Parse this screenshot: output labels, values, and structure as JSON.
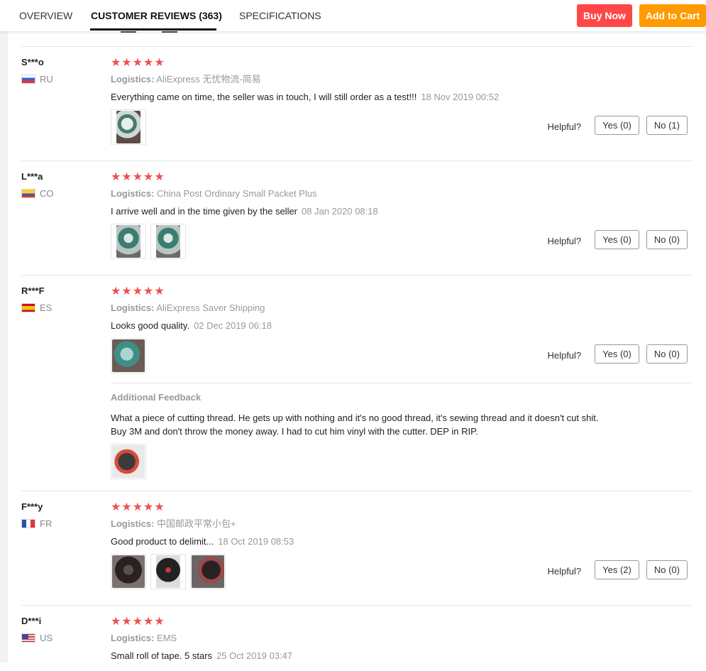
{
  "tabs": [
    {
      "label": "OVERVIEW",
      "active": false
    },
    {
      "label": "CUSTOMER REVIEWS (363)",
      "active": true
    },
    {
      "label": "SPECIFICATIONS",
      "active": false
    }
  ],
  "actions": {
    "buy_now": "Buy Now",
    "add_to_cart": "Add to Cart"
  },
  "colors": {
    "buy_now": "#ff4747",
    "add_to_cart": "#ff9a00",
    "stars": "#f05050"
  },
  "helpful_label": "Helpful?",
  "logistics_label": "Logistics:",
  "reviews": [
    {
      "user": "S***o",
      "country": "RU",
      "stars": "★★★★★",
      "logistics": "AliExpress 无忧物流-简易",
      "text": "Everything came on time, the seller was in touch, I will still order as a test!!!",
      "date": "18 Nov 2019 00:52",
      "yes": "Yes (0)",
      "no": "No (1)"
    },
    {
      "user": "L***a",
      "country": "CO",
      "stars": "★★★★★",
      "logistics": "China Post Ordinary Small Packet Plus",
      "text": "I arrive well and in the time given by the seller",
      "date": "08 Jan 2020 08:18",
      "yes": "Yes (0)",
      "no": "No (0)"
    },
    {
      "user": "R***F",
      "country": "ES",
      "stars": "★★★★★",
      "logistics": "AliExpress Saver Shipping",
      "text": "Looks good quality.",
      "date": "02 Dec 2019 06:18",
      "yes": "Yes (0)",
      "no": "No (0)",
      "additional_title": "Additional Feedback",
      "additional_text": "What a piece of cutting thread. He gets up with nothing and it's no good thread, it's sewing thread and it doesn't cut shit. Buy 3M and don't throw the money away. I had to cut him vinyl with the cutter. DEP in RIP."
    },
    {
      "user": "F***y",
      "country": "FR",
      "stars": "★★★★★",
      "logistics": "中国邮政平常小包+",
      "text": "Good product to delimit...",
      "date": "18 Oct 2019 08:53",
      "yes": "Yes (2)",
      "no": "No (0)"
    },
    {
      "user": "D***i",
      "country": "US",
      "stars": "★★★★★",
      "logistics": "EMS",
      "text": "Small roll of tape. 5 stars",
      "date": "25 Oct 2019 03:47"
    }
  ]
}
